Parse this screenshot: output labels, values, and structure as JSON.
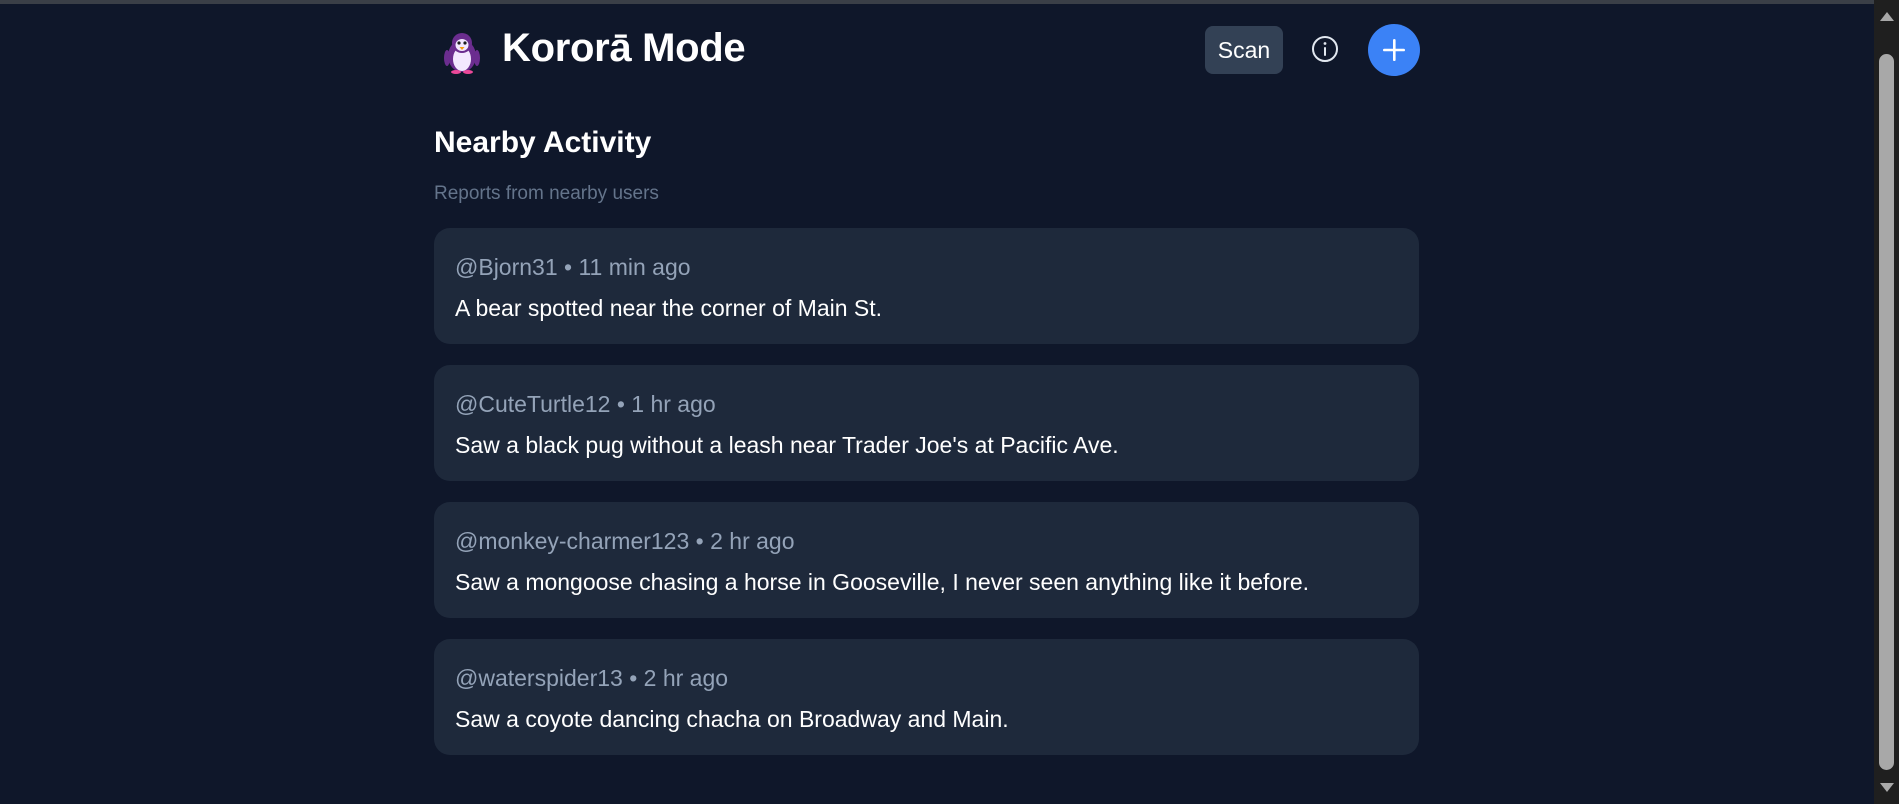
{
  "header": {
    "app_title": "Kororā Mode",
    "scan_label": "Scan",
    "logo_icon": "penguin-icon",
    "info_icon": "info-icon",
    "add_icon": "plus-icon"
  },
  "feed": {
    "title": "Nearby Activity",
    "subtitle": "Reports from nearby users",
    "reports": [
      {
        "user": "@Bjorn31",
        "time": "11 min ago",
        "meta": "@Bjorn31 • 11 min ago",
        "text": "A bear spotted near the corner of Main St."
      },
      {
        "user": "@CuteTurtle12",
        "time": "1 hr ago",
        "meta": "@CuteTurtle12 • 1 hr ago",
        "text": "Saw a black pug without a leash near Trader Joe's at Pacific Ave."
      },
      {
        "user": "@monkey-charmer123",
        "time": "2 hr ago",
        "meta": "@monkey-charmer123 • 2 hr ago",
        "text": "Saw a mongoose chasing a horse in Gooseville, I never seen anything like it before."
      },
      {
        "user": "@waterspider13",
        "time": "2 hr ago",
        "meta": "@waterspider13 • 2 hr ago",
        "text": "Saw a coyote dancing chacha on Broadway and Main."
      }
    ]
  },
  "colors": {
    "background": "#0f172a",
    "card": "#1e293b",
    "scan_button": "#334155",
    "accent": "#3b82f6",
    "muted_text": "#94a3b8",
    "subtitle_text": "#64748b"
  }
}
